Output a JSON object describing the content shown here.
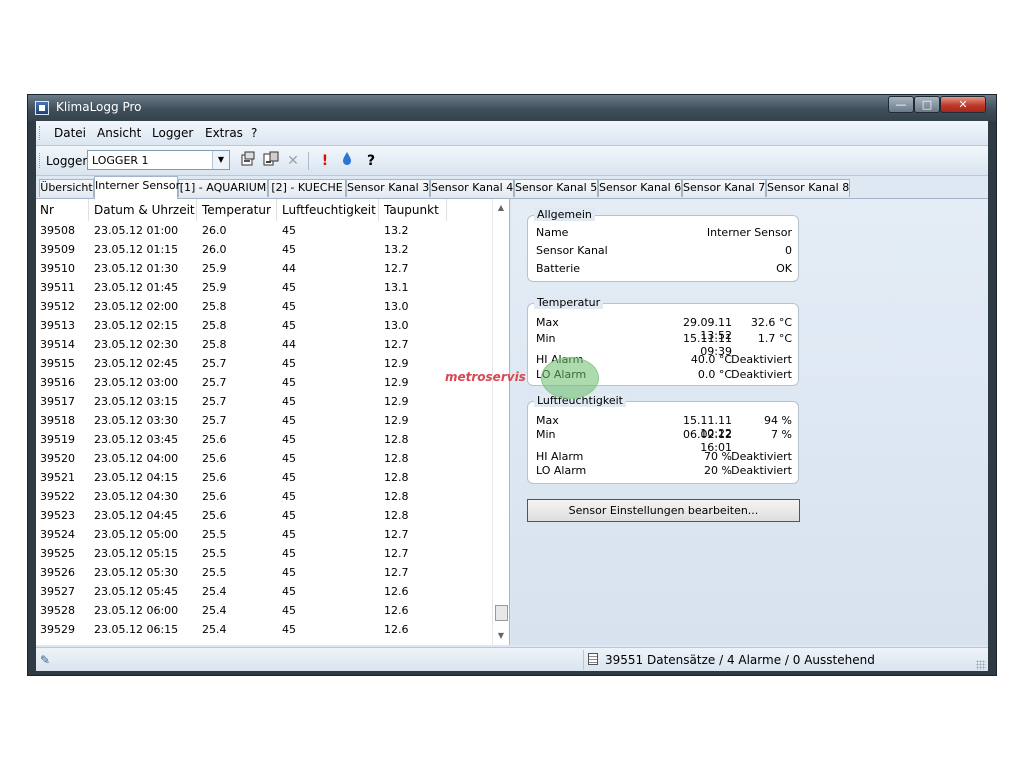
{
  "window": {
    "title": "KlimaLogg Pro"
  },
  "menu": [
    {
      "id": "datei",
      "label": "Datei"
    },
    {
      "id": "ansicht",
      "label": "Ansicht"
    },
    {
      "id": "logger",
      "label": "Logger"
    },
    {
      "id": "extras",
      "label": "Extras"
    },
    {
      "id": "help",
      "label": "?"
    }
  ],
  "toolbar": {
    "logger_label": "Logger",
    "logger_value": "LOGGER 1"
  },
  "tabs": [
    {
      "label": "Übersicht"
    },
    {
      "label": "Interner Sensor",
      "active": true
    },
    {
      "label": "[1] - AQUARIUM"
    },
    {
      "label": "[2] - KUECHE"
    },
    {
      "label": "Sensor Kanal 3"
    },
    {
      "label": "Sensor Kanal 4"
    },
    {
      "label": "Sensor Kanal 5"
    },
    {
      "label": "Sensor Kanal 6"
    },
    {
      "label": "Sensor Kanal 7"
    },
    {
      "label": "Sensor Kanal 8"
    }
  ],
  "table": {
    "columns": [
      "Nr",
      "Datum & Uhrzeit",
      "Temperatur",
      "Luftfeuchtigkeit",
      "Taupunkt"
    ],
    "rows": [
      [
        "39508",
        "23.05.12 01:00",
        "26.0",
        "45",
        "13.2"
      ],
      [
        "39509",
        "23.05.12 01:15",
        "26.0",
        "45",
        "13.2"
      ],
      [
        "39510",
        "23.05.12 01:30",
        "25.9",
        "44",
        "12.7"
      ],
      [
        "39511",
        "23.05.12 01:45",
        "25.9",
        "45",
        "13.1"
      ],
      [
        "39512",
        "23.05.12 02:00",
        "25.8",
        "45",
        "13.0"
      ],
      [
        "39513",
        "23.05.12 02:15",
        "25.8",
        "45",
        "13.0"
      ],
      [
        "39514",
        "23.05.12 02:30",
        "25.8",
        "44",
        "12.7"
      ],
      [
        "39515",
        "23.05.12 02:45",
        "25.7",
        "45",
        "12.9"
      ],
      [
        "39516",
        "23.05.12 03:00",
        "25.7",
        "45",
        "12.9"
      ],
      [
        "39517",
        "23.05.12 03:15",
        "25.7",
        "45",
        "12.9"
      ],
      [
        "39518",
        "23.05.12 03:30",
        "25.7",
        "45",
        "12.9"
      ],
      [
        "39519",
        "23.05.12 03:45",
        "25.6",
        "45",
        "12.8"
      ],
      [
        "39520",
        "23.05.12 04:00",
        "25.6",
        "45",
        "12.8"
      ],
      [
        "39521",
        "23.05.12 04:15",
        "25.6",
        "45",
        "12.8"
      ],
      [
        "39522",
        "23.05.12 04:30",
        "25.6",
        "45",
        "12.8"
      ],
      [
        "39523",
        "23.05.12 04:45",
        "25.6",
        "45",
        "12.8"
      ],
      [
        "39524",
        "23.05.12 05:00",
        "25.5",
        "45",
        "12.7"
      ],
      [
        "39525",
        "23.05.12 05:15",
        "25.5",
        "45",
        "12.7"
      ],
      [
        "39526",
        "23.05.12 05:30",
        "25.5",
        "45",
        "12.7"
      ],
      [
        "39527",
        "23.05.12 05:45",
        "25.4",
        "45",
        "12.6"
      ],
      [
        "39528",
        "23.05.12 06:00",
        "25.4",
        "45",
        "12.6"
      ],
      [
        "39529",
        "23.05.12 06:15",
        "25.4",
        "45",
        "12.6"
      ]
    ]
  },
  "allgemein": {
    "title": "Allgemein",
    "name_label": "Name",
    "name_value": "Interner Sensor",
    "kanal_label": "Sensor Kanal",
    "kanal_value": "0",
    "batterie_label": "Batterie",
    "batterie_value": "OK"
  },
  "temperatur": {
    "title": "Temperatur",
    "max_label": "Max",
    "max_time": "29.09.11 13:52",
    "max_value": "32.6 °C",
    "min_label": "Min",
    "min_time": "15.11.11 09:39",
    "min_value": "1.7 °C",
    "hi_label": "HI Alarm",
    "hi_value": "40.0 °C",
    "hi_state": "Deaktiviert",
    "lo_label": "LO Alarm",
    "lo_value": "0.0 °C",
    "lo_state": "Deaktiviert"
  },
  "luftfeuchtigkeit": {
    "title": "Luftfeuchtigkeit",
    "max_label": "Max",
    "max_time": "15.11.11 10:22",
    "max_value": "94 %",
    "min_label": "Min",
    "min_time": "06.02.12 16:01",
    "min_value": "7 %",
    "hi_label": "HI Alarm",
    "hi_value": "70 %",
    "hi_state": "Deaktiviert",
    "lo_label": "LO Alarm",
    "lo_value": "20 %",
    "lo_state": "Deaktiviert"
  },
  "actions": {
    "edit_sensor": "Sensor Einstellungen bearbeiten..."
  },
  "watermark": {
    "text": "metroservis"
  },
  "status": {
    "text": "39551 Datensätze / 4 Alarme / 0 Ausstehend"
  }
}
